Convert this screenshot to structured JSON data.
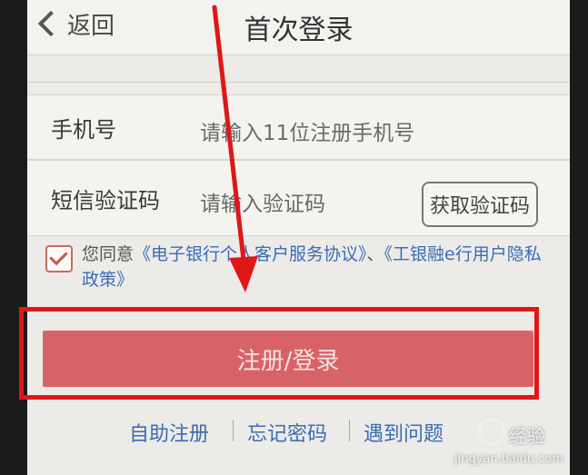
{
  "header": {
    "back_label": "返回",
    "title": "首次登录"
  },
  "form": {
    "phone": {
      "label": "手机号",
      "placeholder": "请输入11位注册手机号"
    },
    "sms": {
      "label": "短信验证码",
      "placeholder": "请输入验证码",
      "get_code_label": "获取验证码"
    }
  },
  "agreement": {
    "checked": true,
    "prefix": "您同意",
    "link1": "《电子银行个人客户服务协议》",
    "joiner": "、",
    "link2": "《工银融e行用户隐私政策》"
  },
  "primary_button": {
    "label": "注册/登录"
  },
  "footer_links": [
    "自助注册",
    "忘记密码",
    "遇到问题"
  ],
  "watermark": {
    "brand": "经验",
    "site": "jingyan.baidu.com"
  },
  "colors": {
    "primary": "#d76368",
    "link": "#3a6db4",
    "highlight": "#e01717"
  }
}
